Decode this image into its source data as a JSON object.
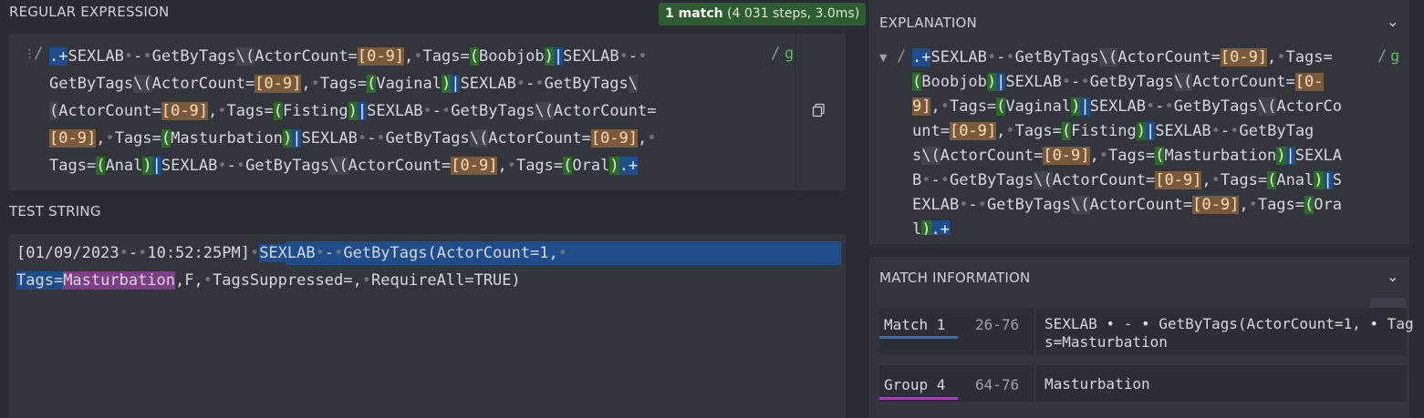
{
  "regex": {
    "title": "REGULAR EXPRESSION",
    "badge_count": "1 match",
    "badge_detail": " (4 031 steps, 3.0ms)",
    "delimiter_open": "/",
    "delimiter_close": "/",
    "flags": "g",
    "lines": [
      [
        [
          "any",
          ".+"
        ],
        [
          "txt",
          "SEXLAB"
        ],
        [
          "dot",
          "•"
        ],
        [
          "txt",
          "-"
        ],
        [
          "dot",
          "•"
        ],
        [
          "txt",
          "GetByTags"
        ],
        [
          "esc",
          "\\("
        ],
        [
          "txt",
          "ActorCount="
        ],
        [
          "cls",
          "[0-9]"
        ],
        [
          "txt",
          ","
        ],
        [
          "dot",
          "•"
        ],
        [
          "txt",
          "Tags="
        ],
        [
          "grp",
          "("
        ],
        [
          "txt",
          "Boobjob"
        ],
        [
          "grp",
          ")"
        ],
        [
          "alt",
          "|"
        ],
        [
          "txt",
          "SEXLAB"
        ],
        [
          "dot",
          "•"
        ],
        [
          "txt",
          "-"
        ],
        [
          "dot",
          "•"
        ]
      ],
      [
        [
          "txt",
          "GetByTags"
        ],
        [
          "esc",
          "\\("
        ],
        [
          "txt",
          "ActorCount="
        ],
        [
          "cls",
          "[0-9]"
        ],
        [
          "txt",
          ","
        ],
        [
          "dot",
          "•"
        ],
        [
          "txt",
          "Tags="
        ],
        [
          "grp",
          "("
        ],
        [
          "txt",
          "Vaginal"
        ],
        [
          "grp",
          ")"
        ],
        [
          "alt",
          "|"
        ],
        [
          "txt",
          "SEXLAB"
        ],
        [
          "dot",
          "•"
        ],
        [
          "txt",
          "-"
        ],
        [
          "dot",
          "•"
        ],
        [
          "txt",
          "GetByTags"
        ],
        [
          "esc",
          "\\"
        ]
      ],
      [
        [
          "esc",
          "("
        ],
        [
          "txt",
          "ActorCount="
        ],
        [
          "cls",
          "[0-9]"
        ],
        [
          "txt",
          ","
        ],
        [
          "dot",
          "•"
        ],
        [
          "txt",
          "Tags="
        ],
        [
          "grp",
          "("
        ],
        [
          "txt",
          "Fisting"
        ],
        [
          "grp",
          ")"
        ],
        [
          "alt",
          "|"
        ],
        [
          "txt",
          "SEXLAB"
        ],
        [
          "dot",
          "•"
        ],
        [
          "txt",
          "-"
        ],
        [
          "dot",
          "•"
        ],
        [
          "txt",
          "GetByTags"
        ],
        [
          "esc",
          "\\("
        ],
        [
          "txt",
          "ActorCount="
        ]
      ],
      [
        [
          "cls",
          "[0-9]"
        ],
        [
          "txt",
          ","
        ],
        [
          "dot",
          "•"
        ],
        [
          "txt",
          "Tags="
        ],
        [
          "grp",
          "("
        ],
        [
          "txt",
          "Masturbation"
        ],
        [
          "grp",
          ")"
        ],
        [
          "alt",
          "|"
        ],
        [
          "txt",
          "SEXLAB"
        ],
        [
          "dot",
          "•"
        ],
        [
          "txt",
          "-"
        ],
        [
          "dot",
          "•"
        ],
        [
          "txt",
          "GetByTags"
        ],
        [
          "esc",
          "\\("
        ],
        [
          "txt",
          "ActorCount="
        ],
        [
          "cls",
          "[0-9]"
        ],
        [
          "txt",
          ","
        ],
        [
          "dot",
          "•"
        ]
      ],
      [
        [
          "txt",
          "Tags="
        ],
        [
          "grp",
          "("
        ],
        [
          "txt",
          "Anal"
        ],
        [
          "grp",
          ")"
        ],
        [
          "alt",
          "|"
        ],
        [
          "txt",
          "SEXLAB"
        ],
        [
          "dot",
          "•"
        ],
        [
          "txt",
          "-"
        ],
        [
          "dot",
          "•"
        ],
        [
          "txt",
          "GetByTags"
        ],
        [
          "esc",
          "\\("
        ],
        [
          "txt",
          "ActorCount="
        ],
        [
          "cls",
          "[0-9]"
        ],
        [
          "txt",
          ","
        ],
        [
          "dot",
          "•"
        ],
        [
          "txt",
          "Tags="
        ],
        [
          "grp",
          "("
        ],
        [
          "txt",
          "Oral"
        ],
        [
          "grp",
          ")"
        ],
        [
          "any",
          ".+"
        ]
      ]
    ]
  },
  "test": {
    "title": "TEST STRING",
    "lines": [
      [
        [
          "txt",
          "[01/09/2023"
        ],
        [
          "dot",
          "•"
        ],
        [
          "txt",
          "-"
        ],
        [
          "dot",
          "•"
        ],
        [
          "txt",
          "10:52:25PM]"
        ],
        [
          "dot",
          "•"
        ],
        [
          "m",
          "SEXLAB"
        ],
        [
          "md",
          "•"
        ],
        [
          "m",
          "-"
        ],
        [
          "md",
          "•"
        ],
        [
          "m",
          "GetByTags(ActorCount=1,"
        ],
        [
          "md",
          "•"
        ]
      ],
      [
        [
          "m",
          "Tags="
        ],
        [
          "g",
          "Masturbation"
        ],
        [
          "txt",
          ",F,"
        ],
        [
          "dot",
          "•"
        ],
        [
          "txt",
          "TagsSuppressed=,"
        ],
        [
          "dot",
          "•"
        ],
        [
          "txt",
          "RequireAll=TRUE)"
        ]
      ]
    ]
  },
  "explanation": {
    "title": "EXPLANATION",
    "lines": [
      [
        [
          "any",
          ".+"
        ],
        [
          "txt",
          "SEXLAB"
        ],
        [
          "dot",
          "•"
        ],
        [
          "txt",
          "-"
        ],
        [
          "dot",
          "•"
        ],
        [
          "txt",
          "GetByTags"
        ],
        [
          "esc",
          "\\("
        ],
        [
          "txt",
          "ActorCount="
        ],
        [
          "cls",
          "[0-9]"
        ],
        [
          "txt",
          ","
        ],
        [
          "dot",
          "•"
        ],
        [
          "txt",
          "Tags="
        ]
      ],
      [
        [
          "grp",
          "("
        ],
        [
          "txt",
          "Boobjob"
        ],
        [
          "grp",
          ")"
        ],
        [
          "alt",
          "|"
        ],
        [
          "txt",
          "SEXLAB"
        ],
        [
          "dot",
          "•"
        ],
        [
          "txt",
          "-"
        ],
        [
          "dot",
          "•"
        ],
        [
          "txt",
          "GetByTags"
        ],
        [
          "esc",
          "\\("
        ],
        [
          "txt",
          "ActorCount="
        ],
        [
          "cls",
          "[0-"
        ]
      ],
      [
        [
          "cls",
          "9]"
        ],
        [
          "txt",
          ","
        ],
        [
          "dot",
          "•"
        ],
        [
          "txt",
          "Tags="
        ],
        [
          "grp",
          "("
        ],
        [
          "txt",
          "Vaginal"
        ],
        [
          "grp",
          ")"
        ],
        [
          "alt",
          "|"
        ],
        [
          "txt",
          "SEXLAB"
        ],
        [
          "dot",
          "•"
        ],
        [
          "txt",
          "-"
        ],
        [
          "dot",
          "•"
        ],
        [
          "txt",
          "GetByTags"
        ],
        [
          "esc",
          "\\("
        ],
        [
          "txt",
          "ActorCo"
        ]
      ],
      [
        [
          "txt",
          "unt="
        ],
        [
          "cls",
          "[0-9]"
        ],
        [
          "txt",
          ","
        ],
        [
          "dot",
          "•"
        ],
        [
          "txt",
          "Tags="
        ],
        [
          "grp",
          "("
        ],
        [
          "txt",
          "Fisting"
        ],
        [
          "grp",
          ")"
        ],
        [
          "alt",
          "|"
        ],
        [
          "txt",
          "SEXLAB"
        ],
        [
          "dot",
          "•"
        ],
        [
          "txt",
          "-"
        ],
        [
          "dot",
          "•"
        ],
        [
          "txt",
          "GetByTag"
        ]
      ],
      [
        [
          "txt",
          "s"
        ],
        [
          "esc",
          "\\("
        ],
        [
          "txt",
          "ActorCount="
        ],
        [
          "cls",
          "[0-9]"
        ],
        [
          "txt",
          ","
        ],
        [
          "dot",
          "•"
        ],
        [
          "txt",
          "Tags="
        ],
        [
          "grp",
          "("
        ],
        [
          "txt",
          "Masturbation"
        ],
        [
          "grp",
          ")"
        ],
        [
          "alt",
          "|"
        ],
        [
          "txt",
          "SEXLA"
        ]
      ],
      [
        [
          "txt",
          "B"
        ],
        [
          "dot",
          "•"
        ],
        [
          "txt",
          "-"
        ],
        [
          "dot",
          "•"
        ],
        [
          "txt",
          "GetByTags"
        ],
        [
          "esc",
          "\\("
        ],
        [
          "txt",
          "ActorCount="
        ],
        [
          "cls",
          "[0-9]"
        ],
        [
          "txt",
          ","
        ],
        [
          "dot",
          "•"
        ],
        [
          "txt",
          "Tags="
        ],
        [
          "grp",
          "("
        ],
        [
          "txt",
          "Anal"
        ],
        [
          "grp",
          ")"
        ],
        [
          "alt",
          "|"
        ],
        [
          "txt",
          "S"
        ]
      ],
      [
        [
          "txt",
          "EXLAB"
        ],
        [
          "dot",
          "•"
        ],
        [
          "txt",
          "-"
        ],
        [
          "dot",
          "•"
        ],
        [
          "txt",
          "GetByTags"
        ],
        [
          "esc",
          "\\("
        ],
        [
          "txt",
          "ActorCount="
        ],
        [
          "cls",
          "[0-9]"
        ],
        [
          "txt",
          ","
        ],
        [
          "dot",
          "•"
        ],
        [
          "txt",
          "Tags="
        ],
        [
          "grp",
          "("
        ],
        [
          "txt",
          "Ora"
        ]
      ],
      [
        [
          "txt",
          "l"
        ],
        [
          "grp",
          ")"
        ],
        [
          "any",
          ".+"
        ]
      ]
    ],
    "delimiter_open": "/",
    "delimiter_close": "/",
    "flags": "g"
  },
  "match_info": {
    "title": "MATCH INFORMATION",
    "rows": [
      {
        "label": "Match 1",
        "range": "26-76",
        "value": "SEXLAB • - • GetByTags(ActorCount=1, • Tag\ns=Masturbation",
        "color": "#2f6fb8"
      },
      {
        "label": "Group 4",
        "range": "64-76",
        "value": "Masturbation",
        "color": "#a345b0"
      }
    ]
  },
  "colors": {
    "match": "#1f4c8a",
    "group": "#7e3d87",
    "badge": "#2f5b30"
  }
}
